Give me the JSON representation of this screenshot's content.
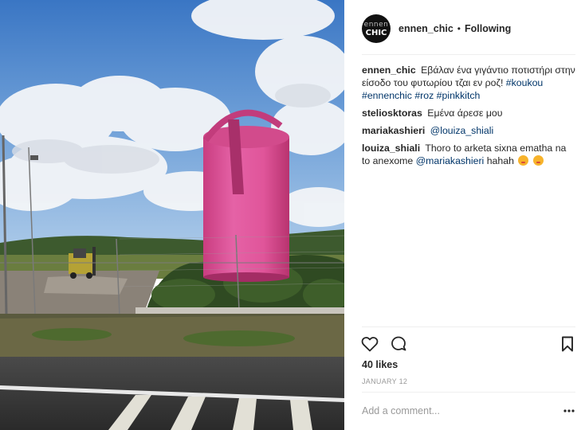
{
  "post": {
    "image_description": "",
    "header": {
      "avatar_line1": "ennen",
      "avatar_line2": "CHIC",
      "username": "ennen_chic",
      "separator": "•",
      "follow_status": "Following"
    },
    "caption": {
      "username": "ennen_chic",
      "text": "Εβάλαν ένα γιγάντιο ποτιστήρι στην είσοδο του φυτωρίου τζαι εν ροζ!",
      "hashtags": [
        "#koukou",
        "#ennenchic",
        "#roz",
        "#pinkkitch"
      ]
    },
    "comments": [
      {
        "username": "steliosktoras",
        "text": "Εμένα άρεσε μου"
      },
      {
        "username": "mariakashieri",
        "mention": "@louiza_shiali"
      },
      {
        "username": "louiza_shiali",
        "text_before": "Thoro to arketa sixna ematha na to anexome",
        "mention": "@mariakashieri",
        "text_after": "hahah"
      }
    ],
    "actions": {
      "like_icon": "heart-icon",
      "comment_icon": "speech-bubble-icon",
      "save_icon": "bookmark-icon"
    },
    "likes": "40 likes",
    "date": "JANUARY 12",
    "add_comment_placeholder": "Add a comment...",
    "more_icon": "more-options-icon"
  },
  "colors": {
    "text": "#262626",
    "link": "#003569",
    "muted": "#999999",
    "divider": "#efefef",
    "pink_can": "#e0559a"
  }
}
